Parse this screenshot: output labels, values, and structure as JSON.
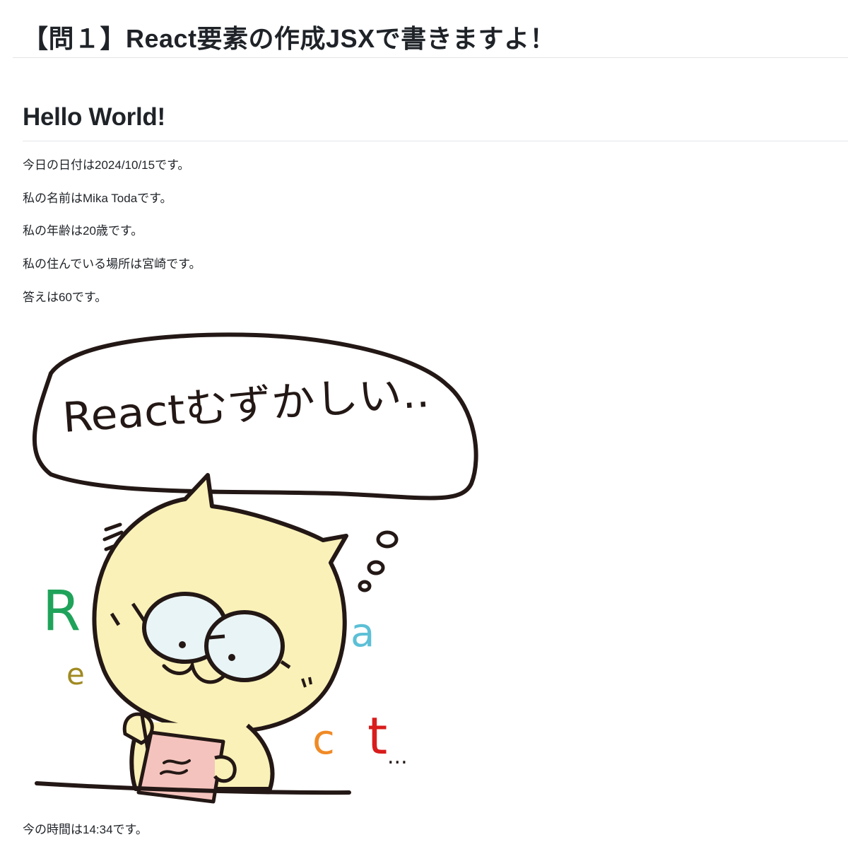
{
  "page": {
    "title": "【問１】React要素の作成JSXで書きますよ！"
  },
  "section": {
    "heading": "Hello World!"
  },
  "lines": {
    "date": "今日の日付は2024/10/15です。",
    "name": "私の名前はMika Todaです。",
    "age": "私の年齢は20歳です。",
    "place": "私の住んでいる場所は宮崎です。",
    "answer": "答えは60です。",
    "time": "今の時間は14:34です。"
  },
  "illustration": {
    "speech_text": "Reactむずかしい..",
    "letter_r": "R",
    "letter_e": "e",
    "letter_a": "a",
    "letter_c": "c",
    "letter_t": "t",
    "ellipsis": "...",
    "colors": {
      "face": "#faf1b8",
      "lens": "#e9f4f6",
      "paper": "#f5c3bd",
      "r": "#1fa35a",
      "e": "#a08a22",
      "a": "#5cc0d6",
      "c": "#f08a25",
      "t": "#d91c1c"
    }
  }
}
